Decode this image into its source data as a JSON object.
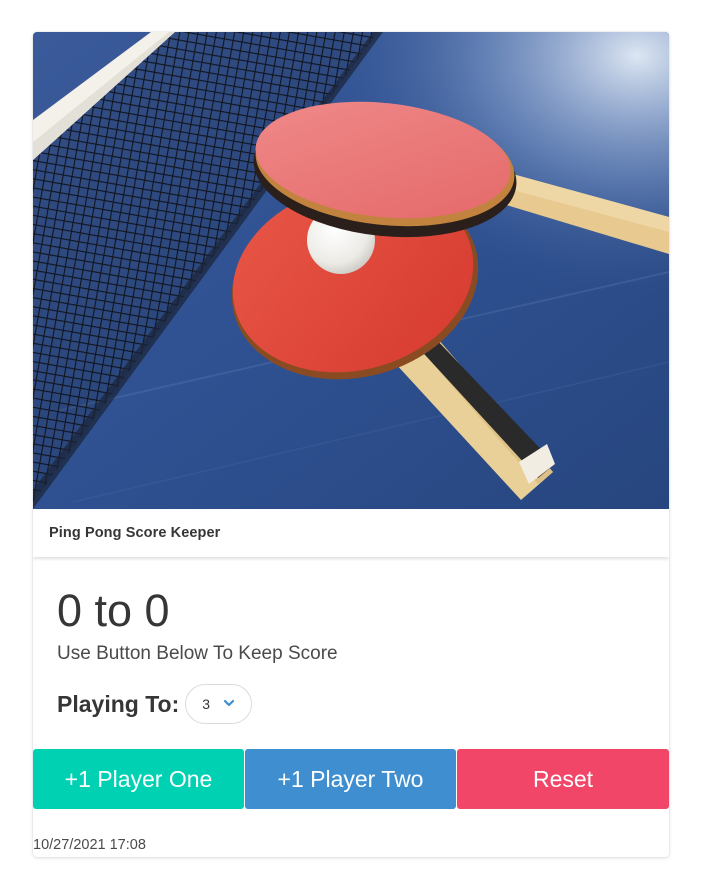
{
  "card": {
    "header_title": "Ping Pong Score Keeper",
    "image_alt": "Ping pong paddles and ball on a table next to the net"
  },
  "score": {
    "display": "0 to 0",
    "player_one": 0,
    "player_two": 0,
    "instruction": "Use Button Below To Keep Score"
  },
  "playing_to": {
    "label": "Playing To:",
    "selected": "3"
  },
  "buttons": {
    "player_one": "+1 Player One",
    "player_two": "+1 Player Two",
    "reset": "Reset"
  },
  "footer": {
    "timestamp": "10/27/2021 17:08"
  },
  "colors": {
    "primary": "#00d1b2",
    "info": "#3e8ed0",
    "danger": "#f14668",
    "text": "#363636"
  }
}
